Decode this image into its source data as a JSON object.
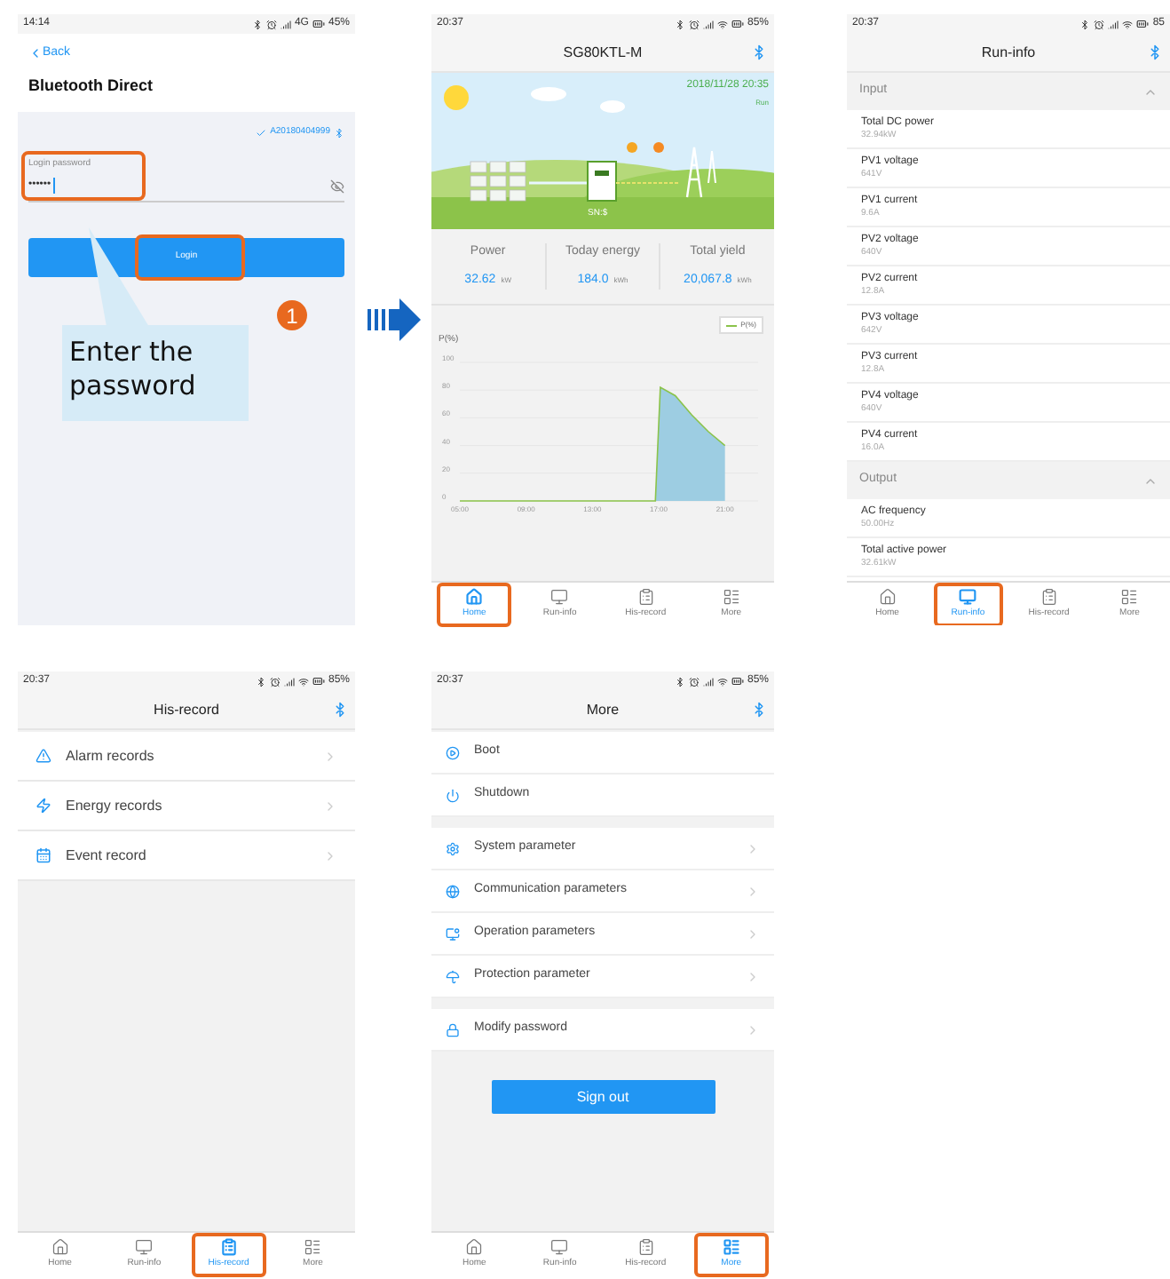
{
  "screens": [
    {
      "kind": "login",
      "status": {
        "time": "14:14",
        "network": "4G",
        "battery": "45%"
      },
      "back": "Back",
      "title": "Bluetooth Direct",
      "device": "A20180404999",
      "field": {
        "label": "Login password",
        "value": "••••••"
      },
      "button": "Login",
      "callout": "Enter the password",
      "step": "1"
    },
    {
      "kind": "home",
      "status": {
        "time": "20:37",
        "battery": "85%"
      },
      "title": "SG80KTL-M",
      "datetime": "2018/11/28 20:35",
      "state": "Run",
      "sn": "SN:$",
      "stats": [
        {
          "label": "Power",
          "value": "32.62",
          "unit": "kW"
        },
        {
          "label": "Today energy",
          "value": "184.0",
          "unit": "kWh"
        },
        {
          "label": "Total yield",
          "value": "20,067.8",
          "unit": "kWh"
        }
      ],
      "chart_data": {
        "type": "area",
        "ylabel": "P(%)",
        "x": [
          5,
          6,
          7,
          8,
          9,
          10,
          11,
          12,
          13,
          14,
          15,
          16,
          16.8,
          17.1,
          18,
          19,
          20,
          21
        ],
        "series": [
          {
            "name": "P(%)",
            "color": "#9dcde2",
            "values": [
              0,
              0,
              0,
              0,
              0,
              0,
              0,
              0,
              0,
              0,
              0,
              0,
              0,
              82,
              76,
              62,
              50,
              40
            ]
          }
        ],
        "grid": true,
        "xlim": [
          5,
          23
        ],
        "ylim": [
          0,
          100
        ],
        "xticks": [
          {
            "value": 5,
            "label": "05:00"
          },
          {
            "value": 9,
            "label": "09:00"
          },
          {
            "value": 13,
            "label": "13:00"
          },
          {
            "value": 17,
            "label": "17:00"
          },
          {
            "value": 21,
            "label": "21:00"
          }
        ],
        "yticks": [
          0,
          20,
          40,
          60,
          80,
          100
        ]
      },
      "tabs": [
        {
          "label": "Home",
          "selected": true
        },
        {
          "label": "Run-info",
          "selected": false
        },
        {
          "label": "His-record",
          "selected": false
        },
        {
          "label": "More",
          "selected": false
        }
      ]
    },
    {
      "kind": "runinfo",
      "status": {
        "time": "20:37",
        "battery": "85"
      },
      "title": "Run-info",
      "sections": [
        {
          "title": "Input",
          "rows": [
            {
              "label": "Total DC power",
              "value": "32.94kW"
            },
            {
              "label": "PV1 voltage",
              "value": "641V"
            },
            {
              "label": "PV1 current",
              "value": "9.6A"
            },
            {
              "label": "PV2 voltage",
              "value": "640V"
            },
            {
              "label": "PV2 current",
              "value": "12.8A"
            },
            {
              "label": "PV3 voltage",
              "value": "642V"
            },
            {
              "label": "PV3 current",
              "value": "12.8A"
            },
            {
              "label": "PV4 voltage",
              "value": "640V"
            },
            {
              "label": "PV4 current",
              "value": "16.0A"
            }
          ]
        },
        {
          "title": "Output",
          "rows": [
            {
              "label": "AC frequency",
              "value": "50.00Hz"
            },
            {
              "label": "Total active power",
              "value": "32.61kW"
            }
          ]
        }
      ],
      "tabs": [
        {
          "label": "Home",
          "selected": false
        },
        {
          "label": "Run-info",
          "selected": true
        },
        {
          "label": "His-record",
          "selected": false
        },
        {
          "label": "More",
          "selected": false
        }
      ]
    },
    {
      "kind": "records",
      "status": {
        "time": "20:37",
        "battery": "85%"
      },
      "title": "His-record",
      "items": [
        {
          "label": "Alarm records"
        },
        {
          "label": "Energy records"
        },
        {
          "label": "Event record"
        }
      ],
      "tabs": [
        {
          "label": "Home",
          "selected": false
        },
        {
          "label": "Run-info",
          "selected": false
        },
        {
          "label": "His-record",
          "selected": true
        },
        {
          "label": "More",
          "selected": false
        }
      ]
    },
    {
      "kind": "more",
      "status": {
        "time": "20:37",
        "battery": "85%"
      },
      "title": "More",
      "groups": [
        [
          {
            "label": "Boot",
            "arrow": false
          },
          {
            "label": "Shutdown",
            "arrow": false
          }
        ],
        [
          {
            "label": "System parameter",
            "arrow": true
          },
          {
            "label": "Communication parameters",
            "arrow": true
          },
          {
            "label": "Operation parameters",
            "arrow": true
          },
          {
            "label": "Protection parameter",
            "arrow": true
          }
        ],
        [
          {
            "label": "Modify password",
            "arrow": true
          }
        ]
      ],
      "button": "Sign out",
      "tabs": [
        {
          "label": "Home",
          "selected": false
        },
        {
          "label": "Run-info",
          "selected": false
        },
        {
          "label": "His-record",
          "selected": false
        },
        {
          "label": "More",
          "selected": true
        }
      ]
    }
  ]
}
